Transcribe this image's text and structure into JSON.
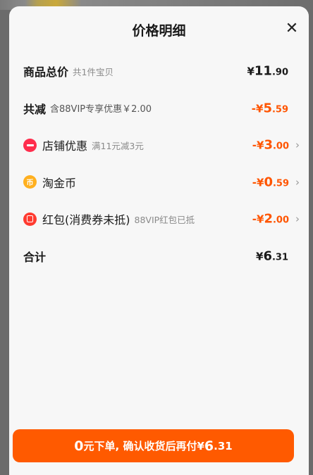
{
  "sheet": {
    "title": "价格明细",
    "close_icon": "✕"
  },
  "rows": [
    {
      "label": "商品总价",
      "sub": "共1件宝贝",
      "amount_sign": "¥",
      "amount_int": "11",
      "amount_dec": ".90"
    },
    {
      "label": "共减",
      "sub": "含88VIP专享优惠￥2.00",
      "amount_sign": "-¥",
      "amount_int": "5",
      "amount_dec": ".59"
    },
    {
      "label": "店铺优惠",
      "sub": "满11元减3元",
      "amount_sign": "-¥",
      "amount_int": "3",
      "amount_dec": ".00",
      "icon": "shop-coupon-icon"
    },
    {
      "label": "淘金币",
      "sub": "",
      "amount_sign": "-¥",
      "amount_int": "0",
      "amount_dec": ".59",
      "icon": "taojinbi-coin-icon",
      "icon_glyph": "币"
    },
    {
      "label": "红包(消费券未抵)",
      "sub": "88VIP红包已抵",
      "amount_sign": "-¥",
      "amount_int": "2",
      "amount_dec": ".00",
      "icon": "red-packet-icon"
    },
    {
      "label": "合计",
      "sub": "",
      "amount_sign": "¥",
      "amount_int": "6",
      "amount_dec": ".31"
    }
  ],
  "chevron": "›",
  "pay_button": {
    "lead_big": "0",
    "lead_text": "元下单, 确认收货后再付",
    "amount_sign": "¥",
    "amount_int": "6",
    "amount_dec": ".31"
  },
  "colors": {
    "accent": "#ff5500",
    "button": "#ff5a00",
    "shop_icon": "#ff2d4d",
    "coin_icon": "#ffb01f",
    "red_packet_icon": "#ff3b30"
  }
}
